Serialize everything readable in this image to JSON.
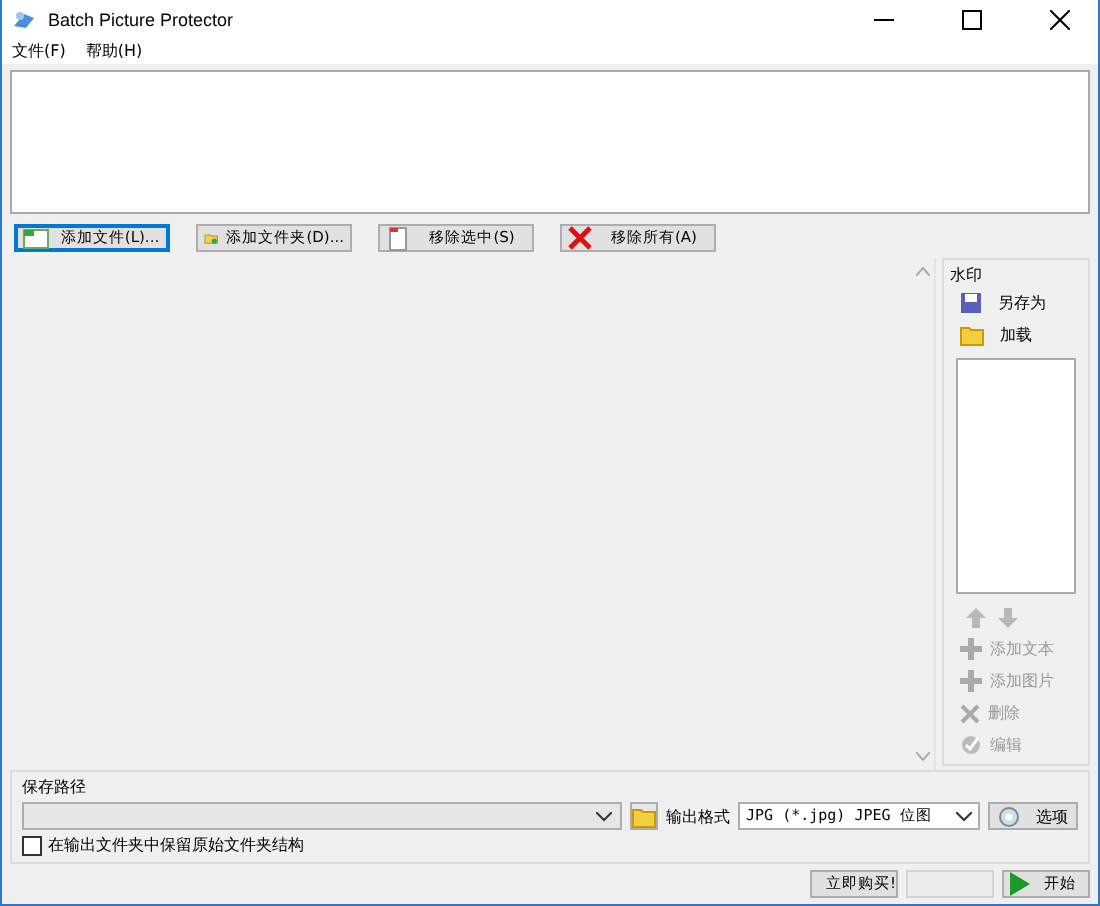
{
  "window": {
    "title": "Batch Picture Protector"
  },
  "menu": [
    "文件(F)",
    "帮助(H)"
  ],
  "file_buttons": [
    {
      "kind": "add-file",
      "label": "添加文件(L)..."
    },
    {
      "kind": "add-folder",
      "label": "添加文件夹(D)..."
    },
    {
      "kind": "remove-selected",
      "label": "移除选中(S)"
    },
    {
      "kind": "remove-all",
      "label": "移除所有(A)"
    }
  ],
  "watermark": {
    "title": "水印",
    "top_actions": [
      {
        "kind": "save",
        "label": "另存为",
        "disabled": false
      },
      {
        "kind": "load",
        "label": "加载",
        "disabled": false
      }
    ],
    "move_buttons": [
      {
        "kind": "up",
        "disabled": true
      },
      {
        "kind": "down",
        "disabled": true
      }
    ],
    "actions": [
      {
        "kind": "add",
        "label": "添加文本",
        "disabled": true
      },
      {
        "kind": "add",
        "label": "添加图片",
        "disabled": true
      },
      {
        "kind": "delete",
        "label": "删除",
        "disabled": true
      },
      {
        "kind": "edit",
        "label": "编辑",
        "disabled": true
      }
    ]
  },
  "save": {
    "title": "保存路径",
    "keep_structure": {
      "label": "在输出文件夹中保留原始文件夹结构",
      "checked": false
    },
    "format_label": "输出格式",
    "format_value": "JPG (*.jpg) JPEG 位图",
    "options_button": "选项"
  },
  "footer_buttons": [
    {
      "kind": "buy",
      "label": "立即购买!",
      "disabled": false
    },
    {
      "kind": "blank",
      "disabled": true
    },
    {
      "kind": "start",
      "label": "开始",
      "disabled": false
    }
  ]
}
